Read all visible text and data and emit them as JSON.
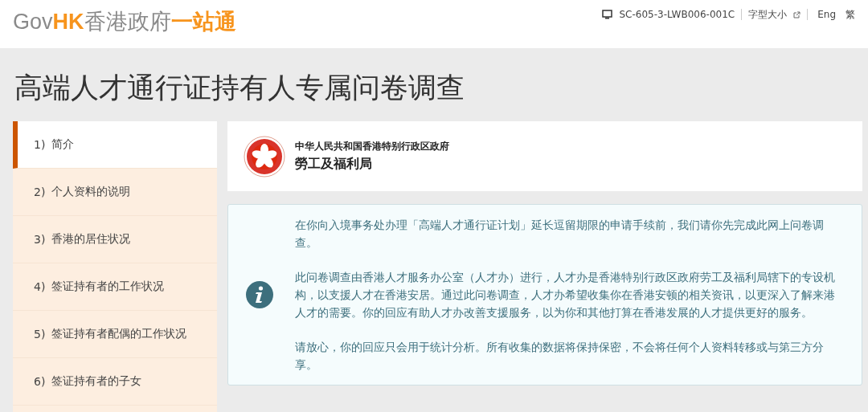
{
  "header": {
    "logo": [
      {
        "text": "Gov",
        "color": "#8a8a8a"
      },
      {
        "text": "HK",
        "color": "#f7941d"
      },
      {
        "text": "香港政府",
        "color": "#8a8a8a"
      },
      {
        "text": "一站通",
        "color": "#f7941d"
      }
    ],
    "device_id": "SC-605-3-LWB006-001C",
    "font_size": "字型大小",
    "languages": [
      "Eng",
      "繁"
    ]
  },
  "page_title": "高端人才通行证持有人专属问卷调查",
  "sidebar": {
    "items": [
      {
        "number": "1)",
        "label": "简介",
        "selected": true
      },
      {
        "number": "2)",
        "label": "个人资料的说明",
        "selected": false
      },
      {
        "number": "3)",
        "label": "香港的居住状况",
        "selected": false
      },
      {
        "number": "4)",
        "label": "签证持有者的工作状况",
        "selected": false
      },
      {
        "number": "5)",
        "label": "签证持有者配偶的工作状况",
        "selected": false
      },
      {
        "number": "6)",
        "label": "签证持有者的子女",
        "selected": false
      }
    ]
  },
  "department": {
    "government": "中华人民共和国香港特别行政区政府",
    "bureau": "勞工及福利局"
  },
  "notice": {
    "paragraphs": [
      "在你向入境事务处办理「高端人才通行证计划」延长逗留期限的申请手续前，我们请你先完成此网上问卷调查。",
      "此问卷调查由香港人才服务办公室（人才办）进行，人才办是香港特别行政区政府劳工及福利局辖下的专设机构，以支援人才在香港安居。通过此问卷调查，人才办希望收集你在香港安顿的相关资讯，以更深入了解来港人才的需要。你的回应有助人才办改善支援服务，以为你和其他打算在香港发展的人才提供更好的服务。",
      "请放心，你的回应只会用于统计分析。所有收集的数据将保持保密，不会将任何个人资料转移或与第三方分享。"
    ]
  }
}
